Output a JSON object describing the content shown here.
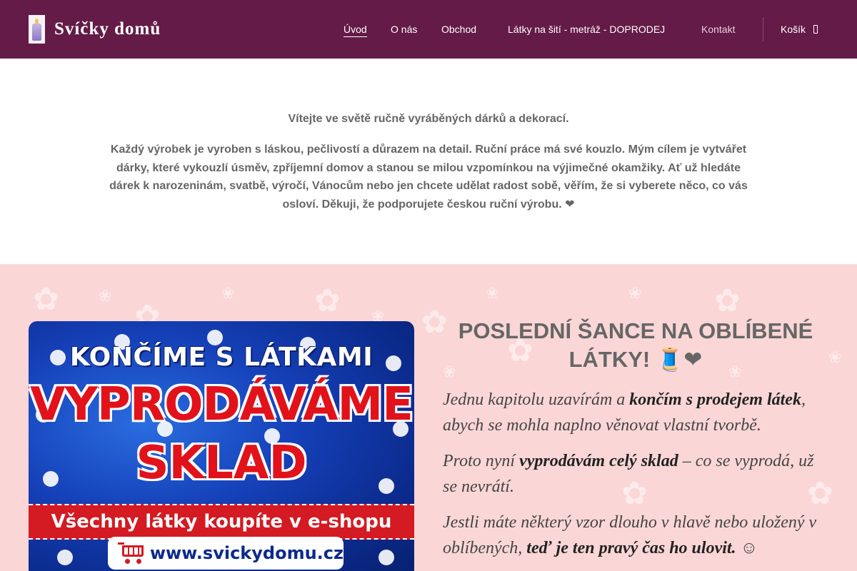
{
  "header": {
    "brand": "Svíčky domů",
    "nav": [
      {
        "label": "Úvod"
      },
      {
        "label": "O nás"
      },
      {
        "label": "Obchod"
      },
      {
        "label": "Látky na šití - metráž - DOPRODEJ"
      },
      {
        "label": "Kontakt"
      }
    ],
    "cart_label": "Košík"
  },
  "intro": {
    "title": "Vítejte ve světě ručně vyráběných dárků a dekorací.",
    "text": "Každý výrobek je vyroben s láskou, pečlivostí a důrazem na detail. Ruční práce má své kouzlo. Mým cílem je vytvářet dárky, které vykouzlí úsměv, zpříjemní domov a stanou se milou vzpomínkou na výjimečné okamžiky. Ať už hledáte dárek k narozeninám, svatbě, výročí, Vánocům nebo jen chcete udělat radost sobě, věřím, že si vyberete něco, co vás osloví. Děkuji, že podporujete českou ruční výrobu. ❤"
  },
  "banner": {
    "line1": "KONČÍME S LÁTKAMI",
    "line2": "VYPRODÁVÁME",
    "line3": "SKLAD",
    "ribbon": "Všechny látky koupíte v e-shopu",
    "url": "www.svickydomu.cz"
  },
  "promo": {
    "heading": "POSLEDNÍ ŠANCE NA OBLÍBENÉ LÁTKY! 🧵❤",
    "p1_a": "Jednu kapitolu uzavírám a ",
    "p1_b": "končím s prodejem látek",
    "p1_c": ", abych se mohla naplno věnovat vlastní tvorbě.",
    "p2_a": "Proto nyní ",
    "p2_b": "vyprodávám celý sklad",
    "p2_c": " – co se vyprodá, už se nevrátí.",
    "p3_a": "Jestli máte některý vzor dlouho v hlavě nebo uložený v oblíbených, ",
    "p3_b": "teď je ten pravý čas ho ulovit.",
    "p3_c": " ☺"
  },
  "colors": {
    "header_bg": "#641b47",
    "promo_bg": "#fad6d6",
    "banner_red": "#e2121a",
    "banner_blue": "#1540b8"
  },
  "icons": {
    "cart": "shopping-bag-icon",
    "logo": "candle-logo-icon"
  }
}
